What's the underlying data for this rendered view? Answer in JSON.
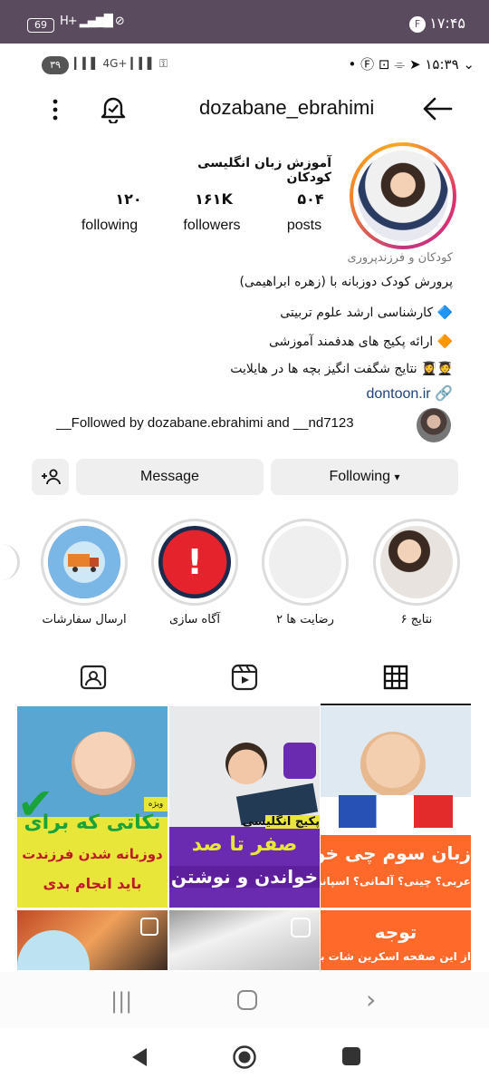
{
  "outer_status": {
    "battery": "69",
    "network": "H+",
    "clock": "۱۷:۴۵",
    "notif": "F"
  },
  "inner_status": {
    "pill": "۳۹",
    "network": "4G+",
    "clock": "۱۵:۳۹"
  },
  "header": {
    "username": "dozabane_ebrahimi"
  },
  "profile": {
    "full_name": "آموزش زبان انگلیسی کودکان",
    "stats": [
      {
        "value": "۵۰۴",
        "label": "posts"
      },
      {
        "value": "۱۶۱K",
        "label": "followers"
      },
      {
        "value": "۱۲۰",
        "label": "following"
      }
    ],
    "category": "کودکان و فرزندپروری",
    "bio": [
      "پرورش کودک دوزبانه با (زهره ابراهیمی)",
      "🔷 کارشناسی ارشد علوم تربیتی",
      "🔶 ارائه پکیج های هدفمند آموزشی",
      "🧑‍🎓👩‍🎓 نتایج شگفت انگیز بچه ها در هایلایت"
    ],
    "link": "dontoon.ir",
    "followed_by": "__Followed by dozabane.ebrahimi and __nd7123"
  },
  "actions": {
    "following": "Following",
    "message": "Message"
  },
  "highlights": [
    {
      "label": "نتایج ۶"
    },
    {
      "label": "رضایت ها ۲"
    },
    {
      "label": "آگاه سازی"
    },
    {
      "label": "ارسال سفارشات"
    }
  ],
  "posts": [
    {
      "line1": "زبان سوم چی خوبه",
      "line2": "عربی؟ چینی؟ آلمانی؟ اسپانیا"
    },
    {
      "line1": "پکیج انگلیسی",
      "line2": "صفر تا صد",
      "line3": "خواندن و نوشتن"
    },
    {
      "badge": "ویژه",
      "line1": "نکاتی که برای",
      "line2": "دوزبانه شدن فرزندت",
      "line3": "باید انجام بدی"
    },
    {
      "line1": "توجه",
      "line2": "از این صفحه اسکرین شات بگ"
    },
    {},
    {}
  ],
  "colors": {
    "link": "#20437a",
    "yellow": "#e9e63a",
    "purple": "#6b2bb0",
    "red": "#ff6a2b"
  }
}
